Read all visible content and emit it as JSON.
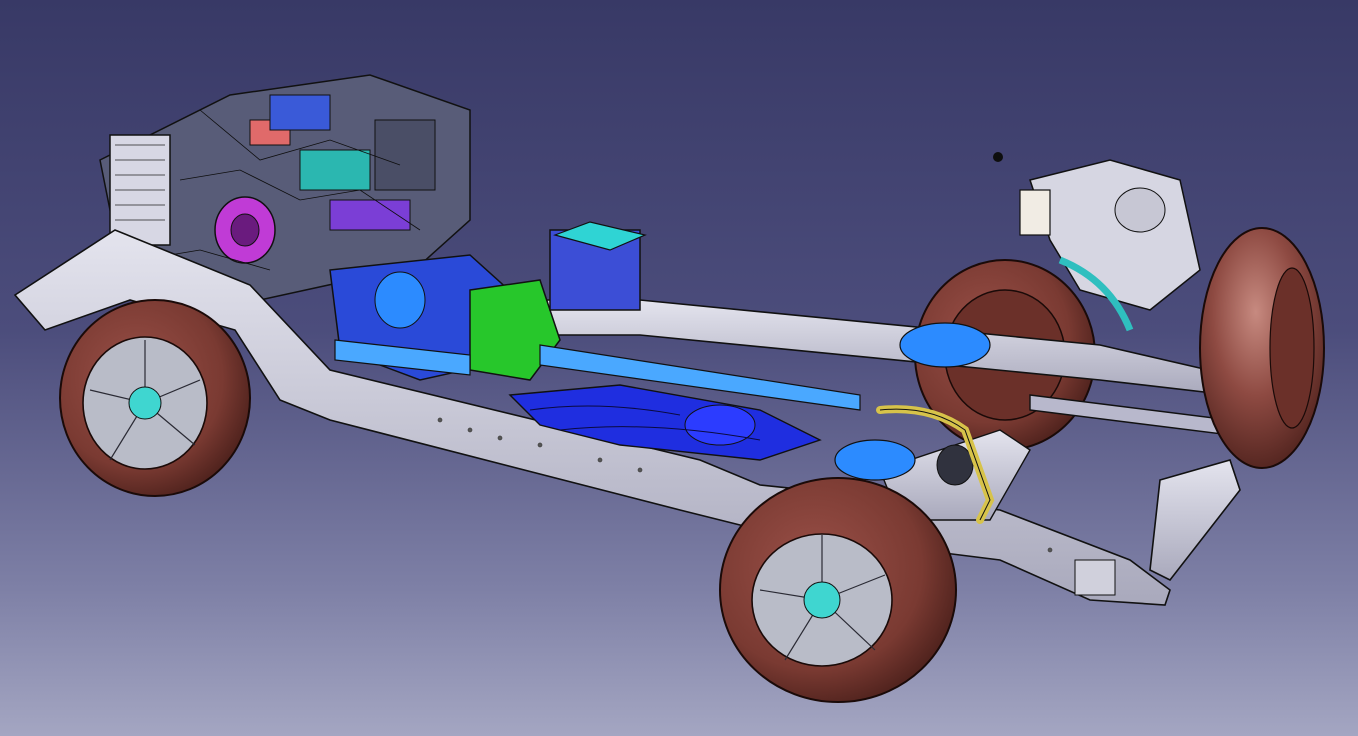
{
  "viewer": {
    "background_top": "#383966",
    "background_bottom": "#a4a6c2"
  },
  "model": {
    "subject": "vehicle-chassis-assembly",
    "frame_color": "#c9c9d6",
    "tire_color": "#7a3a32",
    "rim_color": "#b9bcc8",
    "hub_color": "#3fd6d0",
    "transmission_color": "#1f3cff",
    "transfer_case_color": "#27c72b",
    "driveshaft_color": "#4aa8ff",
    "engine_accent_color": "#c03bd6",
    "coolant_tank_color": "#2fbfbf",
    "exhaust_color": "#d7c34a",
    "axle_color": "#8f8fa3"
  }
}
